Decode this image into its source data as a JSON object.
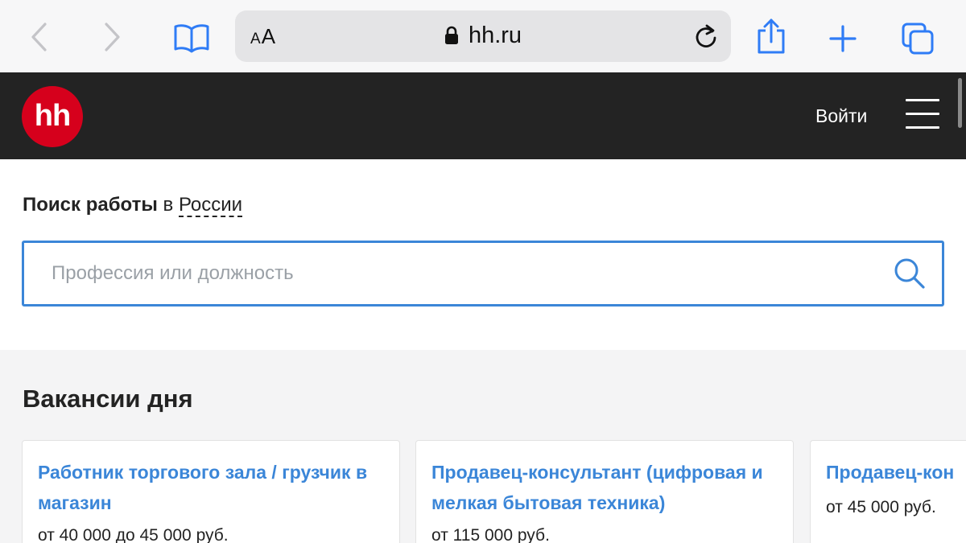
{
  "browser": {
    "text_size_small": "A",
    "text_size_large": "A",
    "url": "hh.ru"
  },
  "header": {
    "logo_text": "hh",
    "login_label": "Войти"
  },
  "search": {
    "title_bold": "Поиск работы",
    "title_preposition": "в",
    "region": "России",
    "placeholder": "Профессия или должность",
    "value": ""
  },
  "vacancies": {
    "title": "Вакансии дня",
    "items": [
      {
        "title": "Работник торгового зала / грузчик в магазин",
        "salary": "от 40 000 до 45 000 руб."
      },
      {
        "title": "Продавец-консультант (цифровая и мелкая бытовая техника)",
        "salary": "от 115 000 руб."
      },
      {
        "title": "Продавец-кон",
        "salary": "от 45 000 руб."
      }
    ]
  },
  "colors": {
    "brand_red": "#d6001c",
    "header_bg": "#232323",
    "link_blue": "#3b86d8",
    "ios_blue": "#2f7cf6"
  },
  "icons": [
    "back-icon",
    "forward-icon",
    "bookmarks-icon",
    "lock-icon",
    "reload-icon",
    "share-icon",
    "new-tab-icon",
    "tabs-icon",
    "menu-icon",
    "search-icon"
  ]
}
